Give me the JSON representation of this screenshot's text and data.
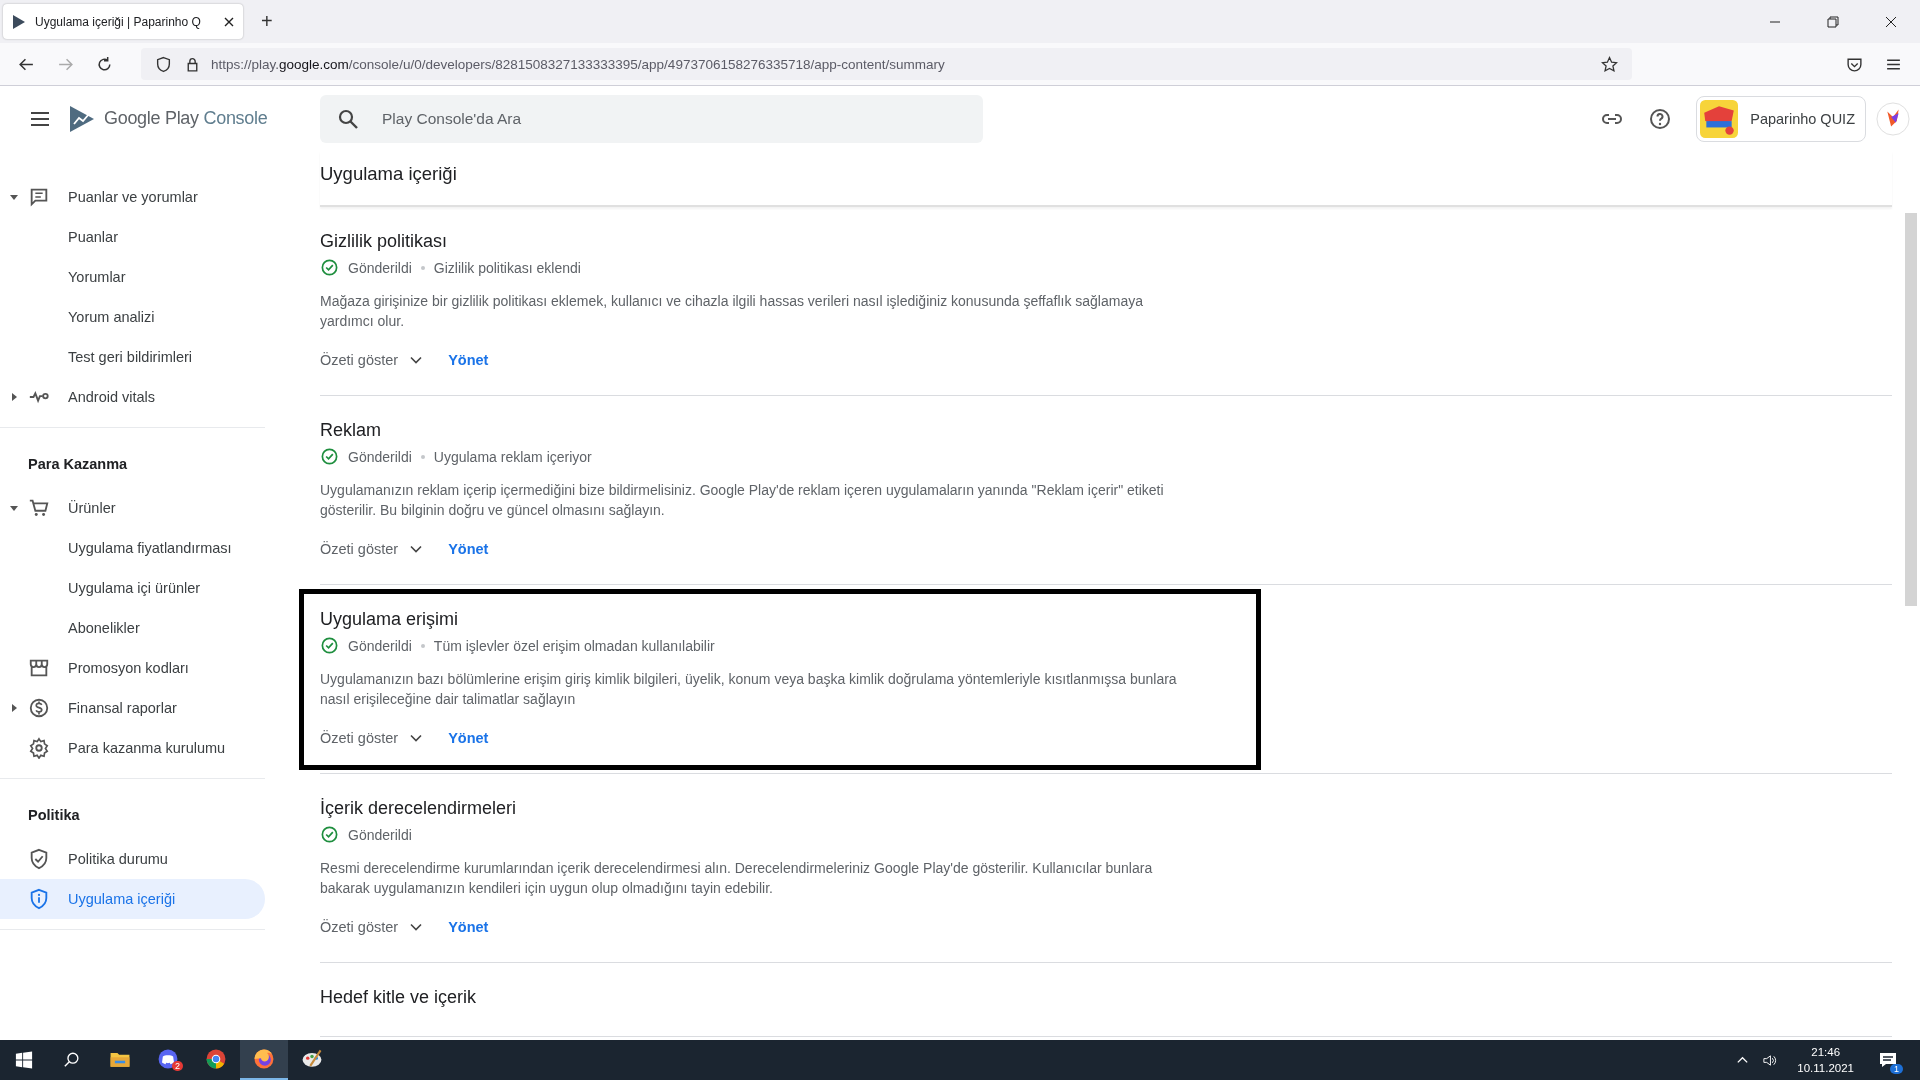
{
  "browser": {
    "tab_title": "Uygulama içeriği | Paparinho Q",
    "new_tab": "+",
    "url": "https://play.**google.com**/console/u/0/developers/8281508327133333395/app/4973706158276335718/app-content/summary"
  },
  "header": {
    "logo_brand": "Google Play",
    "logo_product": "Console",
    "search": {
      "placeholder": "Play Console'da Ara"
    },
    "app_name": "Paparinho QUIZ"
  },
  "sidebar": {
    "sections": [
      {
        "items": [
          {
            "label": "Puanlar ve yorumlar",
            "kind": "group",
            "expanded": true,
            "selected": false,
            "children": [
              {
                "label": "Puanlar",
                "selected": false
              },
              {
                "label": "Yorumlar",
                "selected": false
              },
              {
                "label": "Yorum analizi",
                "selected": false
              },
              {
                "label": "Test geri bildirimleri",
                "selected": false
              }
            ]
          },
          {
            "label": "Android vitals",
            "kind": "group",
            "expanded": false,
            "selected": false
          }
        ]
      },
      {
        "heading": "Para Kazanma",
        "items": [
          {
            "label": "Ürünler",
            "kind": "group",
            "expanded": true,
            "selected": false,
            "children": [
              {
                "label": "Uygulama fiyatlandırması",
                "selected": false
              },
              {
                "label": "Uygulama içi ürünler",
                "selected": false
              },
              {
                "label": "Abonelikler",
                "selected": false
              }
            ]
          },
          {
            "label": "Promosyon kodları",
            "kind": "link",
            "selected": false
          },
          {
            "label": "Finansal raporlar",
            "kind": "group",
            "expanded": false,
            "selected": false
          },
          {
            "label": "Para kazanma kurulumu",
            "kind": "link",
            "selected": false
          }
        ]
      },
      {
        "heading": "Politika",
        "items": [
          {
            "label": "Politika durumu",
            "kind": "link",
            "selected": false
          },
          {
            "label": "Uygulama içeriği",
            "kind": "link",
            "selected": true
          }
        ]
      }
    ]
  },
  "page": {
    "title": "Uygulama içeriği",
    "sections": [
      {
        "title": "Gizlilik politikası",
        "status": "Gönderildi",
        "detail": "Gizlilik politikası eklendi",
        "description": "Mağaza girişinize bir gizlilik politikası eklemek, kullanıcı ve cihazla ilgili hassas verileri nasıl işlediğiniz konusunda şeffaflık sağlamaya yardımcı olur.",
        "summary": "Özeti göster",
        "action": "Yönet",
        "highlighted": false
      },
      {
        "title": "Reklam",
        "status": "Gönderildi",
        "detail": "Uygulama reklam içeriyor",
        "description": "Uygulamanızın reklam içerip içermediğini bize bildirmelisiniz. Google Play'de reklam içeren uygulamaların yanında \"Reklam içerir\" etiketi gösterilir. Bu bilginin doğru ve güncel olmasını sağlayın.",
        "summary": "Özeti göster",
        "action": "Yönet",
        "highlighted": false
      },
      {
        "title": "Uygulama erişimi",
        "status": "Gönderildi",
        "detail": "Tüm işlevler özel erişim olmadan kullanılabilir",
        "description": "Uygulamanızın bazı bölümlerine erişim giriş kimlik bilgileri, üyelik, konum veya başka kimlik doğrulama yöntemleriyle kısıtlanmışsa bunlara nasıl erişileceğine dair talimatlar sağlayın",
        "summary": "Özeti göster",
        "action": "Yönet",
        "highlighted": true
      },
      {
        "title": "İçerik derecelendirmeleri",
        "status": "Gönderildi",
        "description": "Resmi derecelendirme kurumlarından içerik derecelendirmesi alın. Derecelendirmeleriniz Google Play'de gösterilir. Kullanıcılar bunlara bakarak uygulamanızın kendileri için uygun olup olmadığını tayin edebilir.",
        "summary": "Özeti göster",
        "action": "Yönet",
        "highlighted": false
      },
      {
        "title": "Hedef kitle ve içerik",
        "highlighted": false
      }
    ]
  },
  "taskbar": {
    "apps": [
      {
        "kind": "explorer",
        "active": false
      },
      {
        "kind": "chat",
        "active": false,
        "badge": "2"
      },
      {
        "kind": "chrome",
        "active": false
      },
      {
        "kind": "firefox",
        "active": true
      },
      {
        "kind": "paint",
        "active": false
      }
    ],
    "time": "21:46",
    "date": "10.11.2021",
    "notifications": "1"
  }
}
